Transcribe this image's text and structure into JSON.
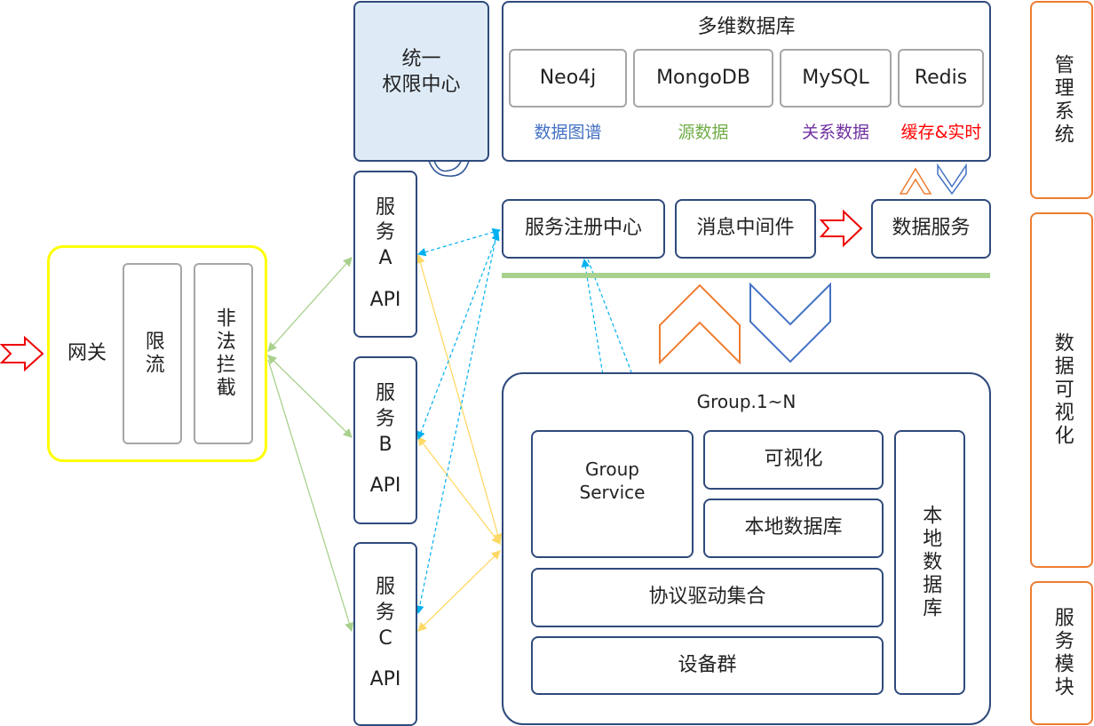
{
  "gateway": {
    "label": "网关",
    "rate_limit": "限流",
    "block_illegal": "非法拦截"
  },
  "auth_center": {
    "line1": "统一",
    "line2": "权限中心"
  },
  "multi_db": {
    "title": "多维数据库",
    "dbs": [
      {
        "name": "Neo4j",
        "desc": "数据图谱",
        "color": "#4472C4"
      },
      {
        "name": "MongoDB",
        "desc": "源数据",
        "color": "#70AD47"
      },
      {
        "name": "MySQL",
        "desc": "关系数据",
        "color": "#7030A0"
      },
      {
        "name": "Redis",
        "desc": "缓存&实时",
        "color": "#FF0000"
      }
    ]
  },
  "services": [
    {
      "line1": "服",
      "line2": "务",
      "letter": "A",
      "api": "API"
    },
    {
      "line1": "服",
      "line2": "务",
      "letter": "B",
      "api": "API"
    },
    {
      "line1": "服",
      "line2": "务",
      "letter": "C",
      "api": "API"
    }
  ],
  "middle": {
    "registry": "服务注册中心",
    "mq": "消息中间件",
    "data_service": "数据服务"
  },
  "group": {
    "title": "Group.1~N",
    "group_service_1": "Group",
    "group_service_2": "Service",
    "visualization": "可视化",
    "local_db": "本地数据库",
    "protocol": "协议驱动集合",
    "devices": "设备群",
    "local_db_vertical": "本地数据库"
  },
  "side": {
    "mgmt": "管理系统",
    "viz": "数据可视化",
    "module": "服务模块"
  },
  "colors": {
    "border": "#2F4A7C",
    "side": "#ED7D31",
    "bus": "#A9D18E",
    "gateway": "#FFFF00",
    "dashed": "#00B0F0",
    "yellow_link": "#FFD966",
    "green_link": "#A9D18E",
    "auth_fill": "#DEEBF7"
  }
}
